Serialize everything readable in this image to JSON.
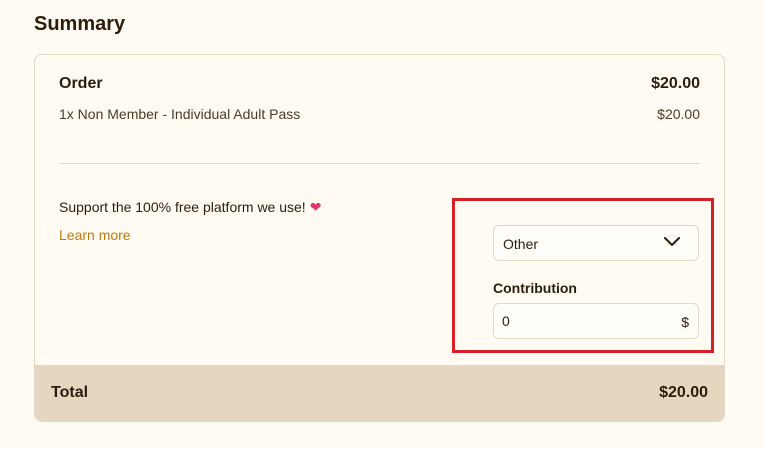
{
  "summary": {
    "title": "Summary"
  },
  "order": {
    "label": "Order",
    "total": "$20.00",
    "items": [
      {
        "description": "1x Non Member - Individual Adult Pass",
        "price": "$20.00"
      }
    ]
  },
  "support": {
    "text": "Support the 100% free platform we use!",
    "learn_more": "Learn more"
  },
  "contribution": {
    "select_value": "Other",
    "label": "Contribution",
    "value": "0",
    "currency": "$"
  },
  "total": {
    "label": "Total",
    "value": "$20.00"
  },
  "colors": {
    "background": "#fffbf2",
    "total_bar": "#e5d6c0",
    "link": "#c07a12",
    "highlight": "#d62027",
    "heart": "#e0326e"
  },
  "icons": {
    "heart": "heart-icon",
    "dropdown": "chevron-down-icon"
  }
}
